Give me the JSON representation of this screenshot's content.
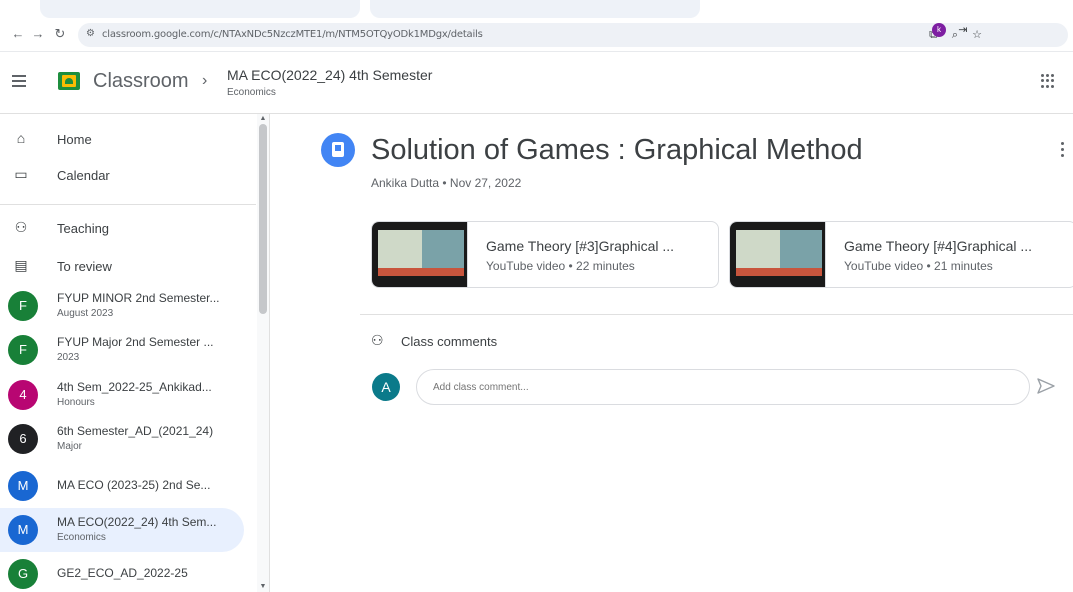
{
  "browser": {
    "url": "classroom.google.com/c/NTAxNDc5NzczMTE1/m/NTM5OTQyODk1MDgx/details",
    "profile_initial": "k",
    "icons": [
      "back-icon",
      "forward-icon",
      "reload-icon",
      "site-info-icon",
      "cast-icon",
      "zoom-icon",
      "bookmark-star-icon",
      "profile-icon",
      "extension-icon"
    ]
  },
  "header": {
    "brand": "Classroom",
    "separator": "›",
    "class_title": "MA ECO(2022_24) 4th Semester",
    "class_subtitle": "Economics"
  },
  "sidebar": {
    "nav": [
      {
        "label": "Home",
        "icon": "home-icon"
      },
      {
        "label": "Calendar",
        "icon": "calendar-icon"
      },
      {
        "label": "Teaching",
        "icon": "people-icon"
      },
      {
        "label": "To review",
        "icon": "review-icon"
      }
    ],
    "classes": [
      {
        "initial": "F",
        "name": "FYUP MINOR 2nd Semester...",
        "sub": "August 2023",
        "color": "#188038"
      },
      {
        "initial": "F",
        "name": "FYUP Major 2nd Semester ...",
        "sub": "2023",
        "color": "#188038"
      },
      {
        "initial": "4",
        "name": "4th Sem_2022-25_Ankikad...",
        "sub": "Honours",
        "color": "#b80672"
      },
      {
        "initial": "6",
        "name": "6th Semester_AD_(2021_24)",
        "sub": "Major",
        "color": "#202124"
      },
      {
        "initial": "M",
        "name": "MA ECO (2023-25) 2nd Se...",
        "sub": "",
        "color": "#1967d2"
      },
      {
        "initial": "M",
        "name": "MA ECO(2022_24) 4th Sem...",
        "sub": "Economics",
        "color": "#1967d2",
        "active": true
      },
      {
        "initial": "G",
        "name": "GE2_ECO_AD_2022-25",
        "sub": "",
        "color": "#188038"
      }
    ]
  },
  "post": {
    "title": "Solution of Games : Graphical Method",
    "meta": "Ankika Dutta • Nov 27, 2022",
    "attachments": [
      {
        "title": "Game Theory [#3]Graphical ...",
        "sub": "YouTube video • 22 minutes"
      },
      {
        "title": "Game Theory [#4]Graphical ...",
        "sub": "YouTube video • 21 minutes"
      }
    ]
  },
  "comments": {
    "label": "Class comments",
    "user_initial": "A",
    "placeholder": "Add class comment..."
  },
  "colors": {
    "accent": "#1a73e8",
    "active_bg": "#e8f0fe",
    "user_avatar": "#0b7a8a"
  }
}
